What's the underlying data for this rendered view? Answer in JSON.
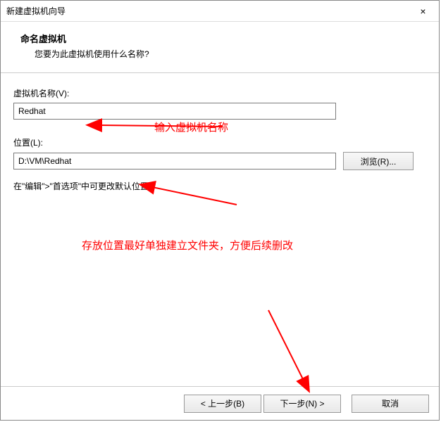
{
  "titlebar": {
    "title": "新建虚拟机向导",
    "close": "×"
  },
  "header": {
    "title": "命名虚拟机",
    "subtitle": "您要为此虚拟机使用什么名称?"
  },
  "fields": {
    "vm_name_label": "虚拟机名称(V):",
    "vm_name_value": "Redhat",
    "location_label": "位置(L):",
    "location_value": "D:\\VM\\Redhat",
    "browse_label": "浏览(R)..."
  },
  "note": "在\"编辑\">\"首选项\"中可更改默认位置。",
  "buttons": {
    "back": "< 上一步(B)",
    "next": "下一步(N) >",
    "cancel": "取消"
  },
  "annotations": {
    "name_hint": "输入虚拟机名称",
    "location_hint": "存放位置最好单独建立文件夹，方便后续删改"
  }
}
